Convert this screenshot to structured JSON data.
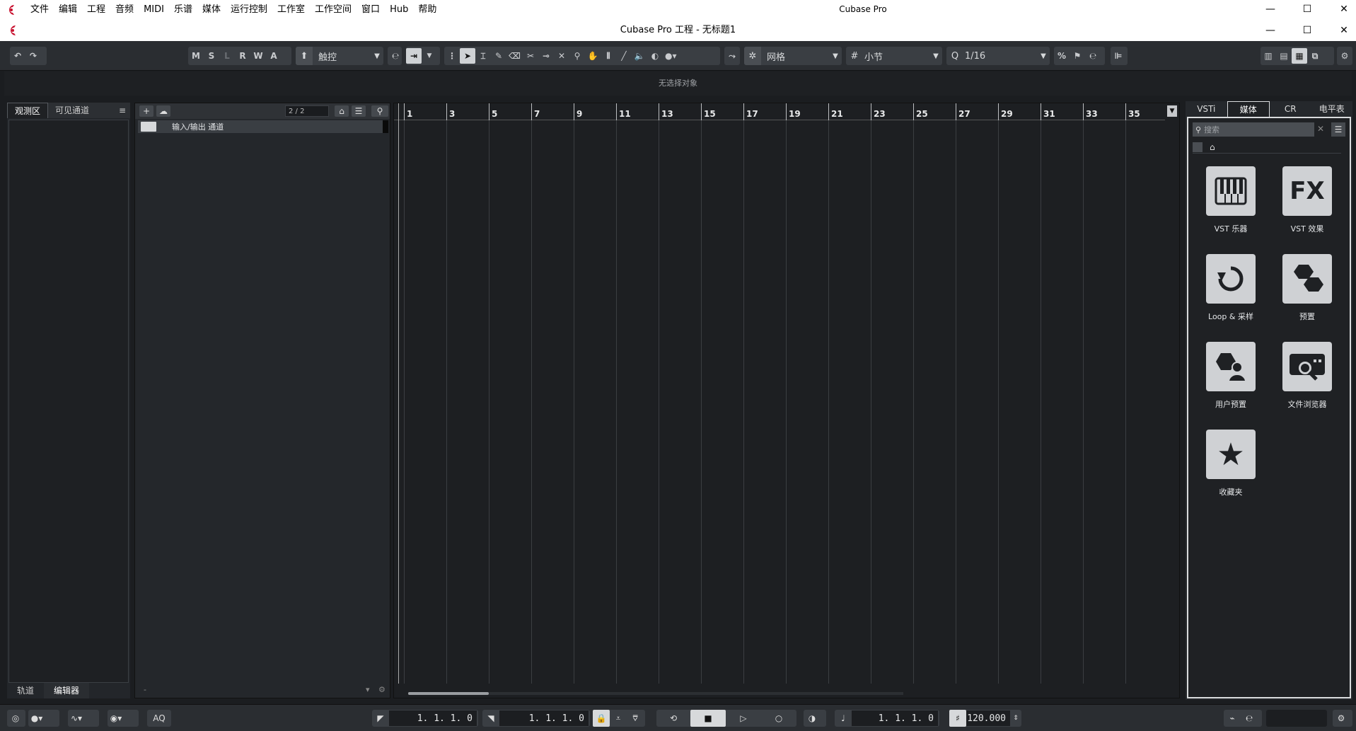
{
  "os": {
    "app_title": "Cubase Pro",
    "menu": [
      "文件",
      "编辑",
      "工程",
      "音频",
      "MIDI",
      "乐谱",
      "媒体",
      "运行控制",
      "工作室",
      "工作空间",
      "窗口",
      "Hub",
      "帮助"
    ]
  },
  "project": {
    "title": "Cubase Pro 工程 - 无标题1"
  },
  "toolbar": {
    "msl": [
      "M",
      "S",
      "L",
      "R",
      "W",
      "A"
    ],
    "automation_mode": "触控",
    "snap_type": "网格",
    "grid_type": "小节",
    "quantize": "1/16"
  },
  "infoline": {
    "text": "无选择对象"
  },
  "left_zone": {
    "tabs": [
      "观测区",
      "可见通道"
    ],
    "menu_icon": "≡",
    "bottom_tabs": [
      "轨道",
      "编辑器"
    ]
  },
  "tracklist": {
    "count": "2 / 2",
    "tracks": [
      {
        "name": "输入/输出 通道",
        "type": "folder"
      }
    ],
    "footer_left": "-"
  },
  "ruler": {
    "bars": [
      "1",
      "3",
      "5",
      "7",
      "9",
      "11",
      "13",
      "15",
      "17",
      "19",
      "21",
      "23",
      "25",
      "27",
      "29",
      "31",
      "33",
      "35"
    ]
  },
  "right_zone": {
    "tabs": [
      "VSTi",
      "媒体",
      "CR",
      "电平表"
    ],
    "search_placeholder": "搜索",
    "tiles": [
      {
        "label": "VST 乐器",
        "icon": "piano-icon"
      },
      {
        "label": "VST 效果",
        "icon": "fx-icon"
      },
      {
        "label": "Loop & 采样",
        "icon": "loop-icon"
      },
      {
        "label": "预置",
        "icon": "hexagons-icon"
      },
      {
        "label": "用户预置",
        "icon": "user-preset-icon"
      },
      {
        "label": "文件浏览器",
        "icon": "file-browser-icon"
      },
      {
        "label": "收藏夹",
        "icon": "star-icon"
      }
    ]
  },
  "transport": {
    "aq": "AQ",
    "left_locator": "1. 1. 1.   0",
    "right_locator": "1. 1. 1.   0",
    "position": "1. 1. 1.   0",
    "tempo": "120.000"
  }
}
